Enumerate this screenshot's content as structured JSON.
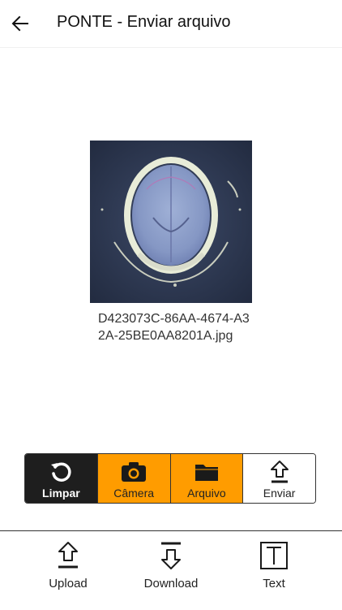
{
  "appbar": {
    "title": "PONTE - Enviar arquivo",
    "back_icon": "arrow-left-icon"
  },
  "preview": {
    "filename": "D423073C-86AA-4674-A32A-25BE0AA8201A.jpg"
  },
  "toolbar": {
    "clear_label": "Limpar",
    "camera_label": "Câmera",
    "file_label": "Arquivo",
    "send_label": "Enviar",
    "accent_color": "#ff9c00"
  },
  "bottom_nav": {
    "upload_label": "Upload",
    "download_label": "Download",
    "text_label": "Text"
  }
}
